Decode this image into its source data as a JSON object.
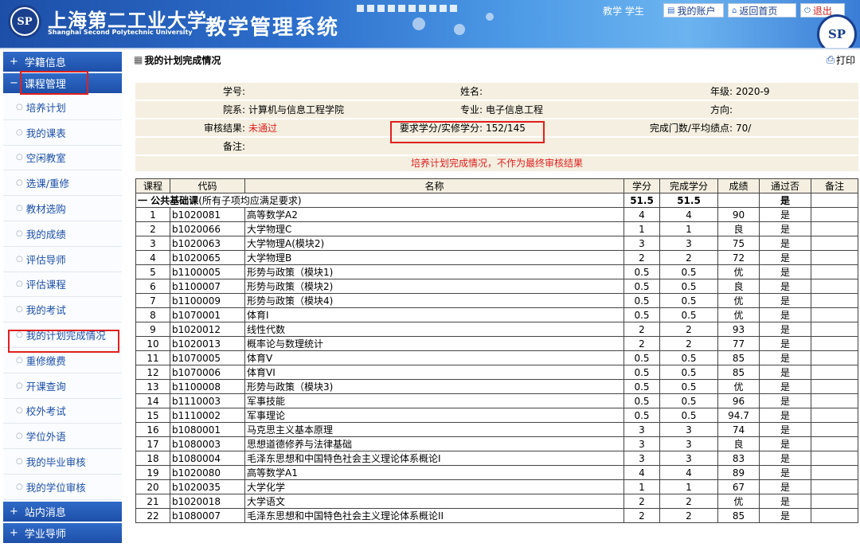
{
  "header": {
    "logo_text": "SP",
    "university_cn": "上海第二工业大学",
    "university_en": "Shanghai Second Polytechnic University",
    "system_title": "教学管理系统",
    "user_role": "教学 学生",
    "buttons": {
      "account": "我的账户",
      "home": "返回首页",
      "logout": "退出"
    },
    "emblem_text": "SP"
  },
  "sidebar": {
    "top_heading": "学籍信息",
    "course_heading": "课程管理",
    "items": [
      {
        "label": "培养计划"
      },
      {
        "label": "我的课表"
      },
      {
        "label": "空闲教室"
      },
      {
        "label": "选课/重修"
      },
      {
        "label": "教材选购"
      },
      {
        "label": "我的成绩"
      },
      {
        "label": "评估导师"
      },
      {
        "label": "评估课程"
      },
      {
        "label": "我的考试"
      },
      {
        "label": "我的计划完成情况"
      },
      {
        "label": "重修缴费"
      },
      {
        "label": "开课查询"
      },
      {
        "label": "校外考试"
      },
      {
        "label": "学位外语"
      },
      {
        "label": "我的毕业审核"
      },
      {
        "label": "我的学位审核"
      }
    ],
    "bottom_headings": [
      "站内消息",
      "学业导师"
    ],
    "icons": {
      "plus": "+",
      "minus": "−",
      "bullet": "○"
    }
  },
  "main": {
    "title": "我的计划完成情况",
    "print_label": "打印",
    "info": {
      "student_id_label": "学号:",
      "student_id_value": "",
      "name_label": "姓名:",
      "name_value": "",
      "grade_label": "年级:",
      "grade_value": "2020-9",
      "dept_label": "院系:",
      "dept_value": "计算机与信息工程学院",
      "major_label": "专业:",
      "major_value": "电子信息工程",
      "direction_label": "方向:",
      "direction_value": "",
      "audit_label": "审核结果:",
      "audit_value": "未通过",
      "credit_label": "要求学分/实修学分:",
      "credit_value": "152/145",
      "gpa_label": "完成门数/平均绩点:",
      "gpa_value": "70/",
      "remark_label": "备注:",
      "remark_value": ""
    },
    "notice": "培养计划完成情况，不作为最终审核结果",
    "table": {
      "headers": [
        "课程",
        "代码",
        "名称",
        "学分",
        "完成学分",
        "成绩",
        "通过否",
        "备注"
      ],
      "category": {
        "name": "一 公共基础课",
        "note": "(所有子项均应满足要求)",
        "credit": "51.5",
        "completed": "51.5",
        "passed": "是"
      },
      "rows": [
        {
          "no": "1",
          "code": "b1020081",
          "name": "高等数学A2",
          "credit": "4",
          "done": "4",
          "score": "90",
          "pass": "是"
        },
        {
          "no": "2",
          "code": "b1020066",
          "name": "大学物理C",
          "credit": "1",
          "done": "1",
          "score": "良",
          "pass": "是"
        },
        {
          "no": "3",
          "code": "b1020063",
          "name": "大学物理A(模块2)",
          "credit": "3",
          "done": "3",
          "score": "75",
          "pass": "是"
        },
        {
          "no": "4",
          "code": "b1020065",
          "name": "大学物理B",
          "credit": "2",
          "done": "2",
          "score": "72",
          "pass": "是"
        },
        {
          "no": "5",
          "code": "b1100005",
          "name": "形势与政策（模块1)",
          "credit": "0.5",
          "done": "0.5",
          "score": "优",
          "pass": "是"
        },
        {
          "no": "6",
          "code": "b1100007",
          "name": "形势与政策（模块2)",
          "credit": "0.5",
          "done": "0.5",
          "score": "良",
          "pass": "是"
        },
        {
          "no": "7",
          "code": "b1100009",
          "name": "形势与政策（模块4)",
          "credit": "0.5",
          "done": "0.5",
          "score": "优",
          "pass": "是"
        },
        {
          "no": "8",
          "code": "b1070001",
          "name": "体育I",
          "credit": "0.5",
          "done": "0.5",
          "score": "优",
          "pass": "是"
        },
        {
          "no": "9",
          "code": "b1020012",
          "name": "线性代数",
          "credit": "2",
          "done": "2",
          "score": "93",
          "pass": "是"
        },
        {
          "no": "10",
          "code": "b1020013",
          "name": "概率论与数理统计",
          "credit": "2",
          "done": "2",
          "score": "77",
          "pass": "是"
        },
        {
          "no": "11",
          "code": "b1070005",
          "name": "体育V",
          "credit": "0.5",
          "done": "0.5",
          "score": "85",
          "pass": "是"
        },
        {
          "no": "12",
          "code": "b1070006",
          "name": "体育VI",
          "credit": "0.5",
          "done": "0.5",
          "score": "85",
          "pass": "是"
        },
        {
          "no": "13",
          "code": "b1100008",
          "name": "形势与政策（模块3)",
          "credit": "0.5",
          "done": "0.5",
          "score": "优",
          "pass": "是"
        },
        {
          "no": "14",
          "code": "b1110003",
          "name": "军事技能",
          "credit": "0.5",
          "done": "0.5",
          "score": "96",
          "pass": "是"
        },
        {
          "no": "15",
          "code": "b1110002",
          "name": "军事理论",
          "credit": "0.5",
          "done": "0.5",
          "score": "94.7",
          "pass": "是"
        },
        {
          "no": "16",
          "code": "b1080001",
          "name": "马克思主义基本原理",
          "credit": "3",
          "done": "3",
          "score": "74",
          "pass": "是"
        },
        {
          "no": "17",
          "code": "b1080003",
          "name": "思想道德修养与法律基础",
          "credit": "3",
          "done": "3",
          "score": "良",
          "pass": "是"
        },
        {
          "no": "18",
          "code": "b1080004",
          "name": "毛泽东思想和中国特色社会主义理论体系概论I",
          "credit": "3",
          "done": "3",
          "score": "83",
          "pass": "是"
        },
        {
          "no": "19",
          "code": "b1020080",
          "name": "高等数学A1",
          "credit": "4",
          "done": "4",
          "score": "89",
          "pass": "是"
        },
        {
          "no": "20",
          "code": "b1020035",
          "name": "大学化学",
          "credit": "1",
          "done": "1",
          "score": "67",
          "pass": "是"
        },
        {
          "no": "21",
          "code": "b1020018",
          "name": "大学语文",
          "credit": "2",
          "done": "2",
          "score": "优",
          "pass": "是"
        },
        {
          "no": "22",
          "code": "b1080007",
          "name": "毛泽东思想和中国特色社会主义理论体系概论II",
          "credit": "2",
          "done": "2",
          "score": "85",
          "pass": "是"
        }
      ]
    }
  }
}
